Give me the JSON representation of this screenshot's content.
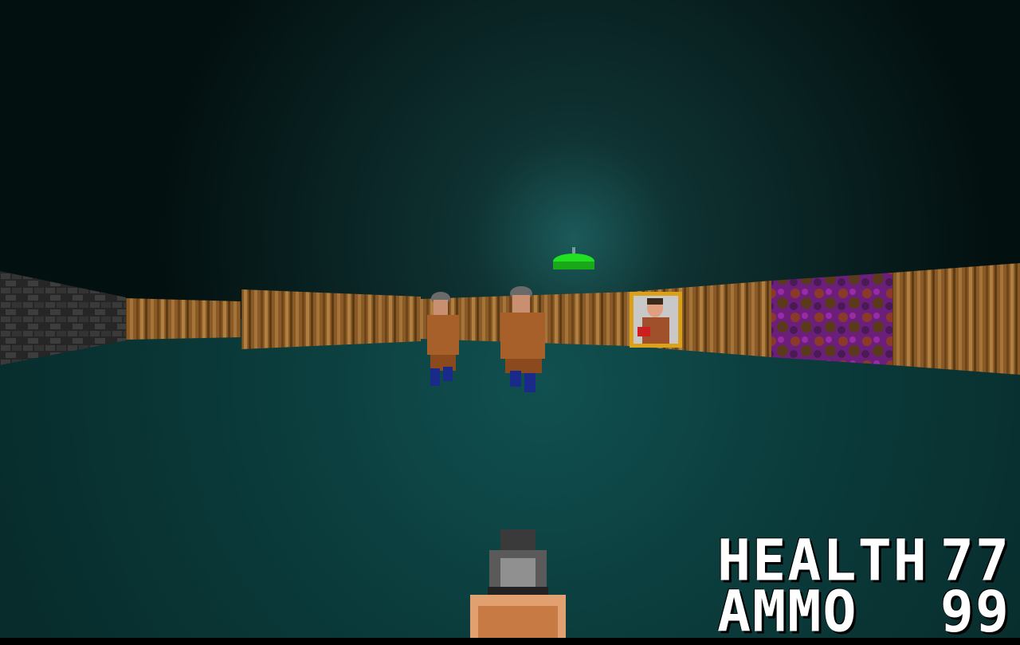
{
  "hud": {
    "health_label": "HEALTH",
    "health_value": "77",
    "ammo_label": "AMMO",
    "ammo_value": "99"
  },
  "colors": {
    "ceiling": "#0a1a1a",
    "floor": "#0d3b3b",
    "wood": "#9a6a30",
    "stone": "#2a2a2a",
    "purple_wall": "#7a1f86",
    "lamp": "#22e022",
    "hud_text": "#ffffff"
  },
  "scene": {
    "weapon": "pistol-icon",
    "lamp": "ceiling-lamp-icon",
    "enemies": [
      "guard-soldier",
      "guard-soldier"
    ],
    "wall_decor": "framed-portrait"
  }
}
